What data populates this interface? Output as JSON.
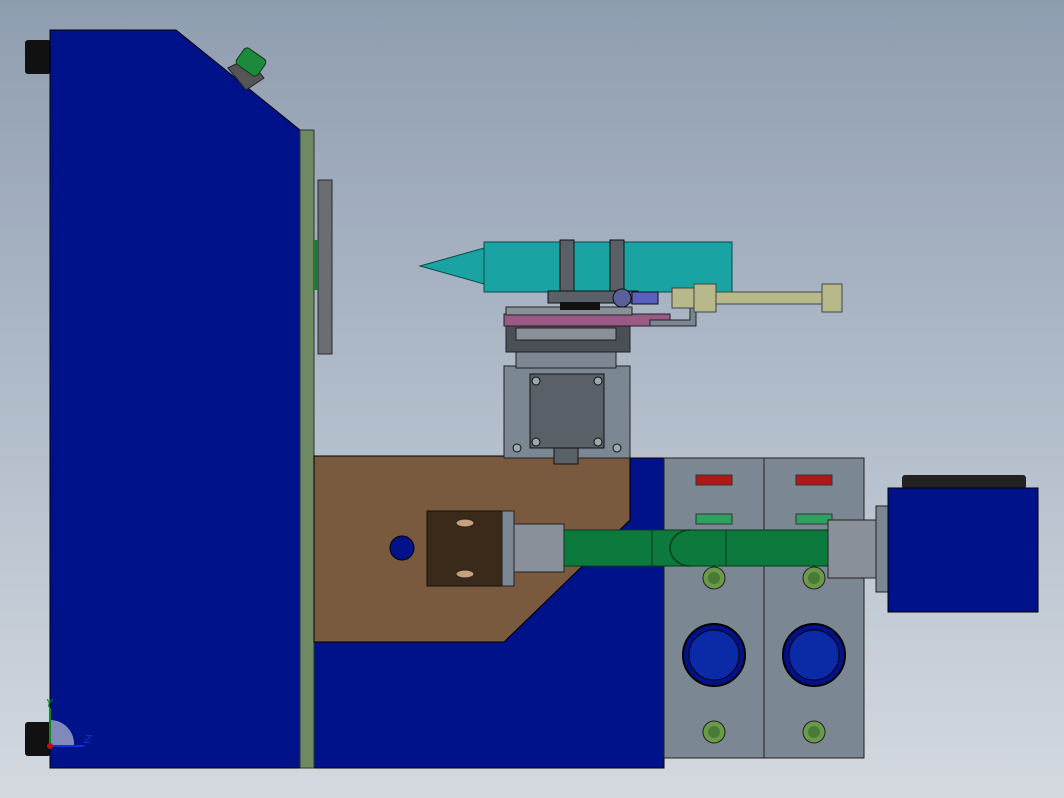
{
  "viewport": {
    "background_top": "#8f9db0",
    "background_bottom": "#d4d9e0"
  },
  "colors": {
    "frame_blue": "#00128a",
    "panel_green": "#6f8a62",
    "plate_brown": "#7a5a3e",
    "barrel_teal": "#1aa3a3",
    "pipe_green": "#0b7a3c",
    "valve_gray": "#7c8794",
    "steel_gray": "#8a9099",
    "indicator_red": "#b01818",
    "indicator_green": "#2ea060",
    "khaki": "#b8b98a"
  },
  "triad": {
    "y_label": "Y",
    "z_label": "Z"
  }
}
